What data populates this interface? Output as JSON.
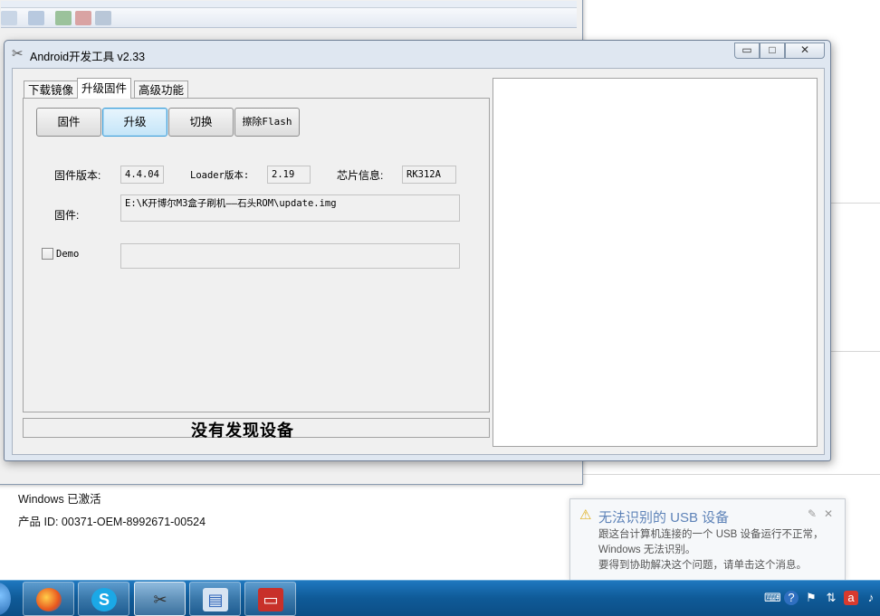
{
  "desktop": {
    "system_info": {
      "activation": "Windows 已激活",
      "product_id": "产品 ID: 00371-OEM-8992671-00524"
    }
  },
  "app": {
    "title": "Android开发工具 v2.33",
    "tabs": [
      "下载镜像",
      "升级固件",
      "高级功能"
    ],
    "active_tab": "升级固件",
    "buttons": {
      "firmware": "固件",
      "upgrade": "升级",
      "switch": "切换",
      "erase_flash": "擦除Flash"
    },
    "info": {
      "firmware_version_label": "固件版本:",
      "firmware_version": "4.4.04",
      "loader_version_label": "Loader版本:",
      "loader_version": "2.19",
      "chip_info_label": "芯片信息:",
      "chip_info": "RK312A"
    },
    "firmware_path_label": "固件:",
    "firmware_path": "E:\\K开博尔M3盒子刷机——石头ROM\\update.img",
    "demo_label": "Demo",
    "demo_checked": false,
    "status": "没有发现设备"
  },
  "notification": {
    "title": "无法识别的 USB 设备",
    "lines": [
      "跟这台计算机连接的一个 USB 设备运行不正常，",
      "Windows 无法识别。",
      "要得到协助解决这个问题，请单击这个消息。"
    ]
  },
  "taskbar": {
    "apps": [
      "firefox",
      "skype",
      "android-tool",
      "control-panel",
      "toolbox"
    ]
  },
  "colors": {
    "accent": "#3c9fd9",
    "taskbar": "#0f5a97",
    "notification_title": "#5e83b8"
  }
}
